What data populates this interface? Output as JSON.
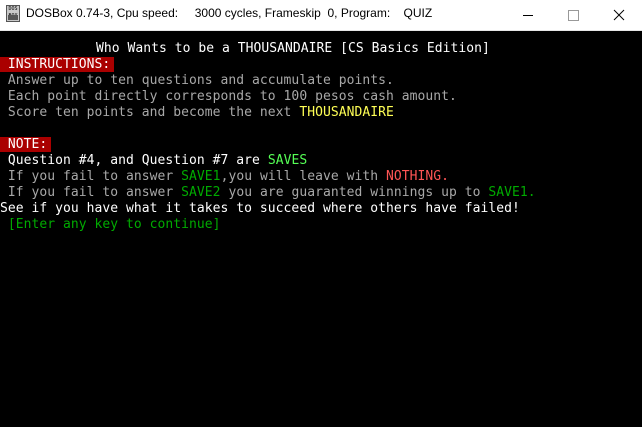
{
  "titlebar": {
    "icon_text": "DOS BOX",
    "title": "DOSBox 0.74-3, Cpu speed:     3000 cycles, Frameskip  0, Program:    QUIZ",
    "minimize_glyph": "—",
    "maximize_glyph": "☐",
    "close_glyph": "✕"
  },
  "screen": {
    "title": "Who Wants to be a THOUSANDAIRE [CS Basics Edition]",
    "instructions_header": " INSTRUCTIONS:",
    "instructions": {
      "line1": " Answer up to ten questions and accumulate points.",
      "line2": " Each point directly corresponds to 100 pesos cash amount.",
      "line3_pre": " Score ten points and become the next ",
      "line3_highlight": "THOUSANDAIRE"
    },
    "note_header": " NOTE:",
    "note": {
      "line1_pre": " Question #4, and Question #7 are ",
      "line1_saves": "SAVES",
      "line2_pre": " If you fail to answer ",
      "line2_save": "SAVE1",
      "line2_mid": ",you will leave with ",
      "line2_nothing": "NOTHING.",
      "line3_pre": " If you fail to answer ",
      "line3_save": "SAVE2",
      "line3_mid": " you are guaranted winnings up to ",
      "line3_save1": "SAVE1."
    },
    "challenge": "See if you have what it takes to succeed where others have failed!",
    "continue_prompt": " [Enter any key to continue]"
  },
  "colors": {
    "header_bg": "#aa0000",
    "yellow": "#ffff55",
    "light_green": "#55ff55",
    "dark_green": "#00aa00",
    "red": "#ff5555",
    "gray": "#a8a8a8"
  }
}
